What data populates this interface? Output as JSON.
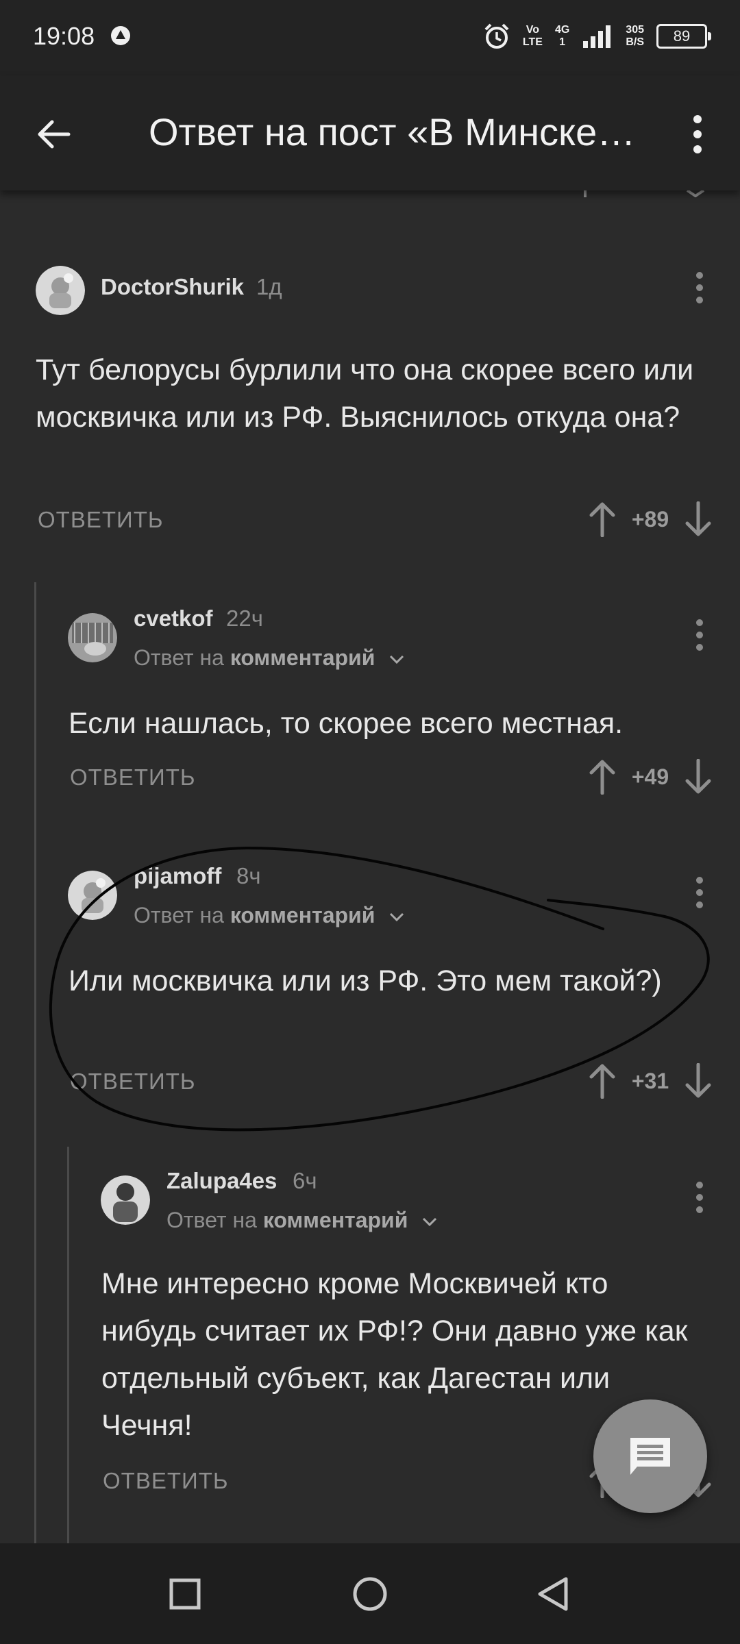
{
  "status_bar": {
    "time": "19:08",
    "volte_top": "Vo",
    "volte_bottom": "LTE",
    "network_top": "4G",
    "network_bottom": "1",
    "speed_value": "305",
    "speed_unit": "B/S",
    "battery": "89",
    "icons": [
      "app-notification-icon",
      "alarm-icon",
      "signal-icon",
      "battery-icon"
    ]
  },
  "app_bar": {
    "title": "Ответ на пост «В Минске наш",
    "icons": [
      "back-arrow-icon",
      "more-vert-icon"
    ]
  },
  "comments": [
    {
      "author": "DoctorShurik",
      "time": "1д",
      "reply_to_prefix": "",
      "reply_to_target": "",
      "text": "Тут белорусы бурлили что она скорее всего или москвичка или из РФ. Выяснилось откуда она?",
      "reply_label": "ОТВЕТИТЬ",
      "score": "+89"
    },
    {
      "author": "cvetkof",
      "time": "22ч",
      "reply_to_prefix": "Ответ на",
      "reply_to_target": "комментарий",
      "text": "Если нашлась, то скорее всего местная.",
      "reply_label": "ОТВЕТИТЬ",
      "score": "+49"
    },
    {
      "author": "pijamoff",
      "time": "8ч",
      "reply_to_prefix": "Ответ на",
      "reply_to_target": "комментарий",
      "text": "Или москвичка или из РФ. Это мем такой?)",
      "reply_label": "ОТВЕТИТЬ",
      "score": "+31"
    },
    {
      "author": "Zalupa4es",
      "time": "6ч",
      "reply_to_prefix": "Ответ на",
      "reply_to_target": "комментарий",
      "text": "Мне интересно кроме Москвичей кто нибудь считает их РФ!? Они давно уже как отдельный субъект, как Дагестан или Чечня!",
      "reply_label": "ОТВЕТИТЬ",
      "score": ""
    }
  ],
  "fab": {
    "icon": "comment-icon"
  },
  "nav_bar": {
    "icons": [
      "recents-square-icon",
      "home-circle-icon",
      "back-triangle-icon"
    ]
  },
  "colors": {
    "background": "#2b2b2b",
    "bars": "#232323",
    "text": "#e8e8e8",
    "muted": "#8d8d8d",
    "fab": "#8b8b8b"
  }
}
